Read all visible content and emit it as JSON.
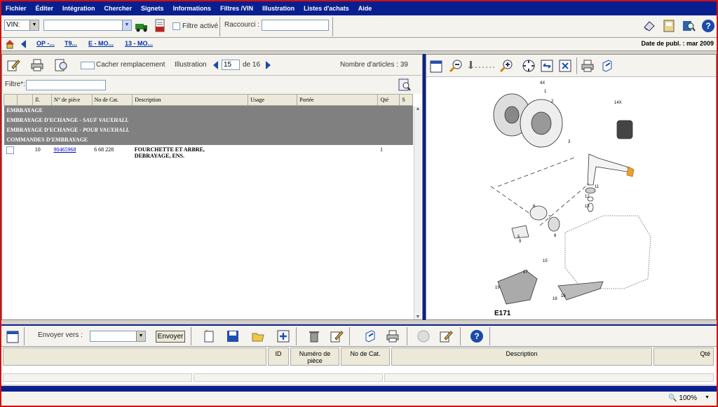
{
  "menu": [
    "Fichier",
    "Éditer",
    "Intégration",
    "Chercher",
    "Signets",
    "Informations",
    "Filtres /VIN",
    "Illustration",
    "Listes d'achats",
    "Aide"
  ],
  "toolbar": {
    "vin_value": "VIN:",
    "filtre_label": "Filtre activé",
    "raccourci_label": "Raccourci :"
  },
  "breadcrumbs": [
    "OP -...",
    "T9...",
    "E - MO...",
    "13 - MO..."
  ],
  "pub_date": "Date de publ. : mar 2009",
  "left_toolbar": {
    "cacher_label": "Cacher remplacement",
    "illustration_label": "Illustration",
    "page_current": "15",
    "de_label": "de 16",
    "articles_label": "Nombre d'articles : 39"
  },
  "filtre_label": "Filtre*:",
  "table": {
    "headers": [
      "",
      "",
      "Il.",
      "N° de pièce",
      "No de Cat.",
      "Description",
      "Usage",
      "Portée",
      "Qté",
      "S"
    ],
    "groups": [
      {
        "main": "EMBRAYAGE",
        "sub": ""
      },
      {
        "main": "EMBRAYAGE D'ECHANGE",
        "sub": " - SAUF VAUXHALL"
      },
      {
        "main": "EMBRAYAGE D'ECHANGE",
        "sub": " - POUR VAUXHALL"
      },
      {
        "main": "COMMANDES D'EMBRAYAGE",
        "sub": ""
      }
    ],
    "row": {
      "il": "10",
      "part_no": "90465968",
      "cat_no": "6 68 228",
      "desc_line1": "FOURCHETTE ET ARBRE,",
      "desc_line2": "DEBRAYAGE, ENS.",
      "qty": "1"
    }
  },
  "diagram": {
    "code": "E171",
    "labels": [
      "4X",
      "1",
      "2",
      "3",
      "14X",
      "11",
      "12",
      "13",
      "6",
      "7",
      "8",
      "5",
      "9",
      "15",
      "17",
      "16",
      "18",
      "19"
    ]
  },
  "bottom": {
    "send_label": "Envoyer vers :",
    "send_button": "Envoyer",
    "headers": [
      "ID",
      "Numéro de pièce",
      "No de Cat.",
      "Description",
      "Qté"
    ]
  },
  "status": {
    "zoom": "100%"
  },
  "colors": {
    "menu_blue": "#0a1f8f",
    "frame_red": "#d01010",
    "highlight": "#f0a030"
  }
}
